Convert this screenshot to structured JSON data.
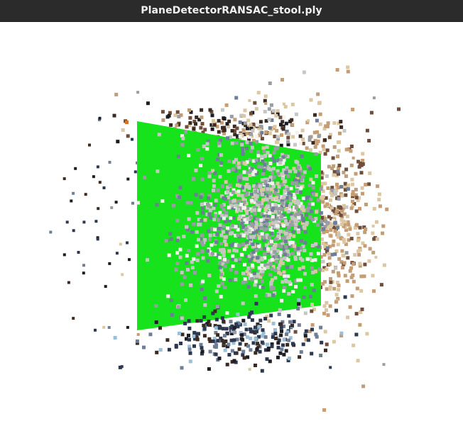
{
  "window": {
    "title": "PlaneDetectorRANSAC_stool.ply"
  },
  "scene": {
    "background_color": "#ffffff",
    "plane_color": "#16e31c",
    "point_palette": {
      "dark": "#1c1c22",
      "navy": "#2c3850",
      "blue_gray": "#6d7e96",
      "gray": "#9a9ea4",
      "light_gray": "#c6c6c2",
      "beige": "#dcc7a3",
      "tan": "#c49d74",
      "brown": "#6e4e3a",
      "dark_brown": "#3a2a22",
      "white": "#f4f2ee",
      "orange": "#d2742a",
      "sky": "#9bbfd6"
    }
  }
}
